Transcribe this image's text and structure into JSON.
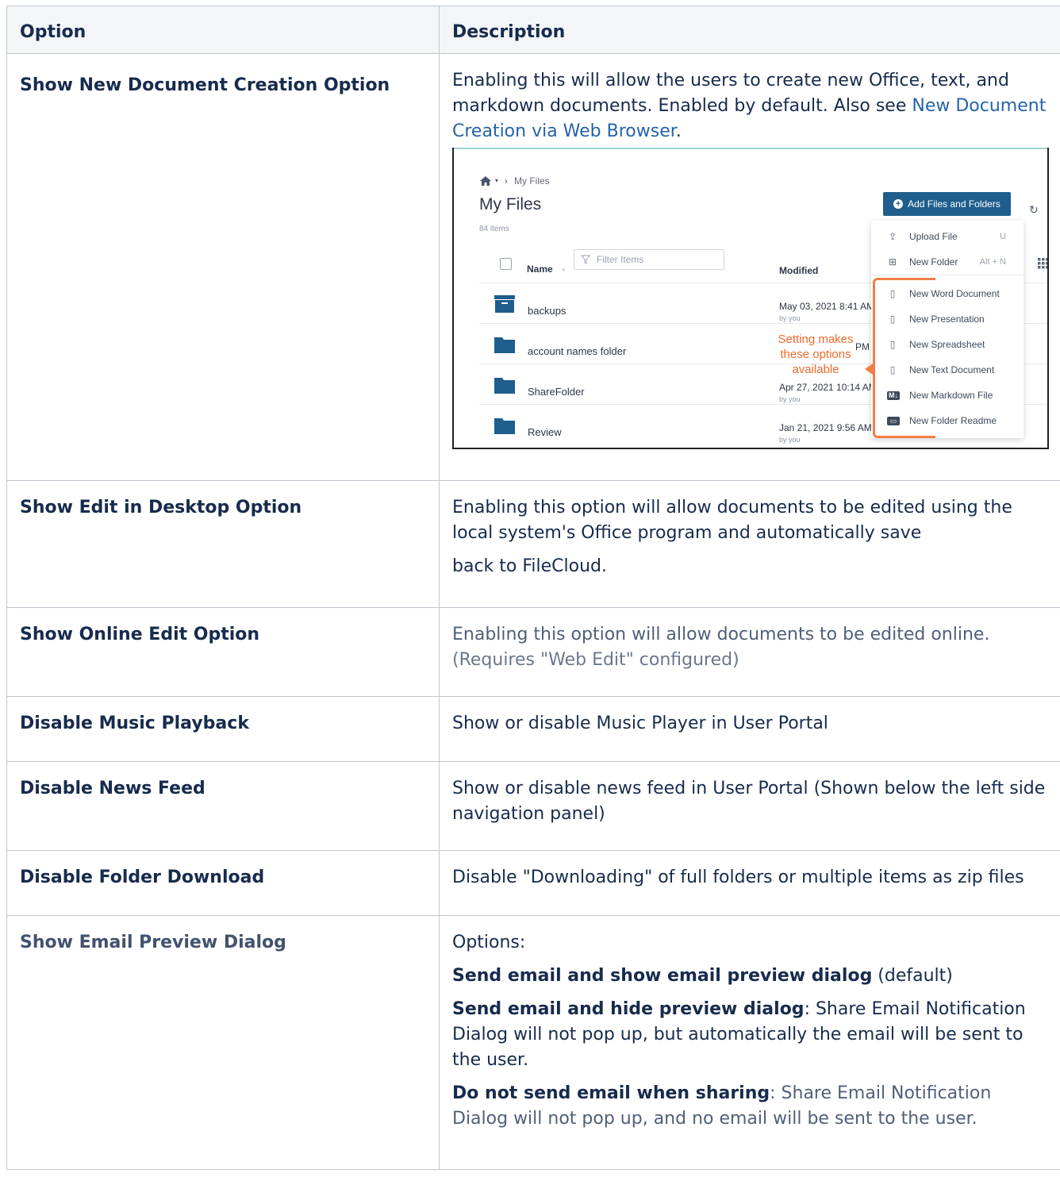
{
  "table": {
    "headers": {
      "option": "Option",
      "description": "Description"
    },
    "rows": [
      {
        "option": "Show New Document Creation Option",
        "desc_before_link": "Enabling this will allow the users to create new Office, text, and markdown documents. Enabled by default. Also see ",
        "link": "New Document Creation via Web Browser",
        "desc_after_link": "."
      },
      {
        "option": "Show Edit in Desktop Option",
        "desc_lines": [
          "Enabling this option will allow documents to be edited using the local system's Office program and automatically save",
          "back to FileCloud."
        ]
      },
      {
        "option": "Show Online Edit Option",
        "desc": "Enabling this option will allow documents to be edited online.",
        "note": "(Requires \"Web Edit\" configured)"
      },
      {
        "option": "Disable Music Playback",
        "desc": "Show or disable Music Player in User Portal"
      },
      {
        "option": "Disable News Feed",
        "desc": "Show or disable news feed in User Portal (Shown below the left side navigation panel)"
      },
      {
        "option": "Disable Folder Download",
        "desc": "Disable \"Downloading\" of full folders or multiple items as zip files"
      },
      {
        "option": "Show Email Preview Dialog",
        "intro": "Options:",
        "choices": [
          {
            "bold": "Send email and show email preview dialog",
            "text": " (default)"
          },
          {
            "bold": "Send email and hide preview dialog",
            "text": ": Share Email Notification Dialog will not pop up, but automatically the email will be sent to the user."
          },
          {
            "bold": "Do not send email when sharing",
            "text": ": Share Email Notification Dialog will not pop up, and no email will be sent to the user."
          }
        ]
      }
    ]
  },
  "screenshot": {
    "breadcrumb": "My Files",
    "title": "My Files",
    "count": "84 items",
    "add_button": "Add Files and Folders",
    "name_header": "Name",
    "filter_placeholder": "Filter Items",
    "modified_header": "Modified",
    "files": [
      {
        "name": "backups",
        "date": "May 03, 2021 8:41 AM",
        "by": "by you",
        "icon": "archive-folder-icon"
      },
      {
        "name": "account names folder",
        "date": "PM",
        "by": "",
        "icon": "folder-icon"
      },
      {
        "name": "ShareFolder",
        "date": "Apr 27, 2021 10:14 AM",
        "by": "by you",
        "icon": "folder-icon"
      },
      {
        "name": "Review",
        "date": "Jan 21, 2021 9:56 AM",
        "by": "by you",
        "icon": "folder-icon"
      }
    ],
    "menu": [
      {
        "label": "Upload File",
        "key": "U",
        "icon": "upload-icon"
      },
      {
        "label": "New Folder",
        "key": "Alt + N",
        "icon": "new-folder-icon"
      },
      {
        "label": "New Word Document",
        "key": "",
        "icon": "word-doc-icon"
      },
      {
        "label": "New Presentation",
        "key": "",
        "icon": "presentation-icon"
      },
      {
        "label": "New Spreadsheet",
        "key": "",
        "icon": "spreadsheet-icon"
      },
      {
        "label": "New Text Document",
        "key": "",
        "icon": "text-doc-icon"
      },
      {
        "label": "New Markdown File",
        "key": "",
        "icon": "markdown-icon"
      },
      {
        "label": "New Folder Readme",
        "key": "",
        "icon": "readme-icon"
      }
    ],
    "callout_lines": [
      "Setting makes",
      "these options",
      "available"
    ],
    "accent": "#1f5e8c",
    "callout_color": "#f07f45"
  }
}
